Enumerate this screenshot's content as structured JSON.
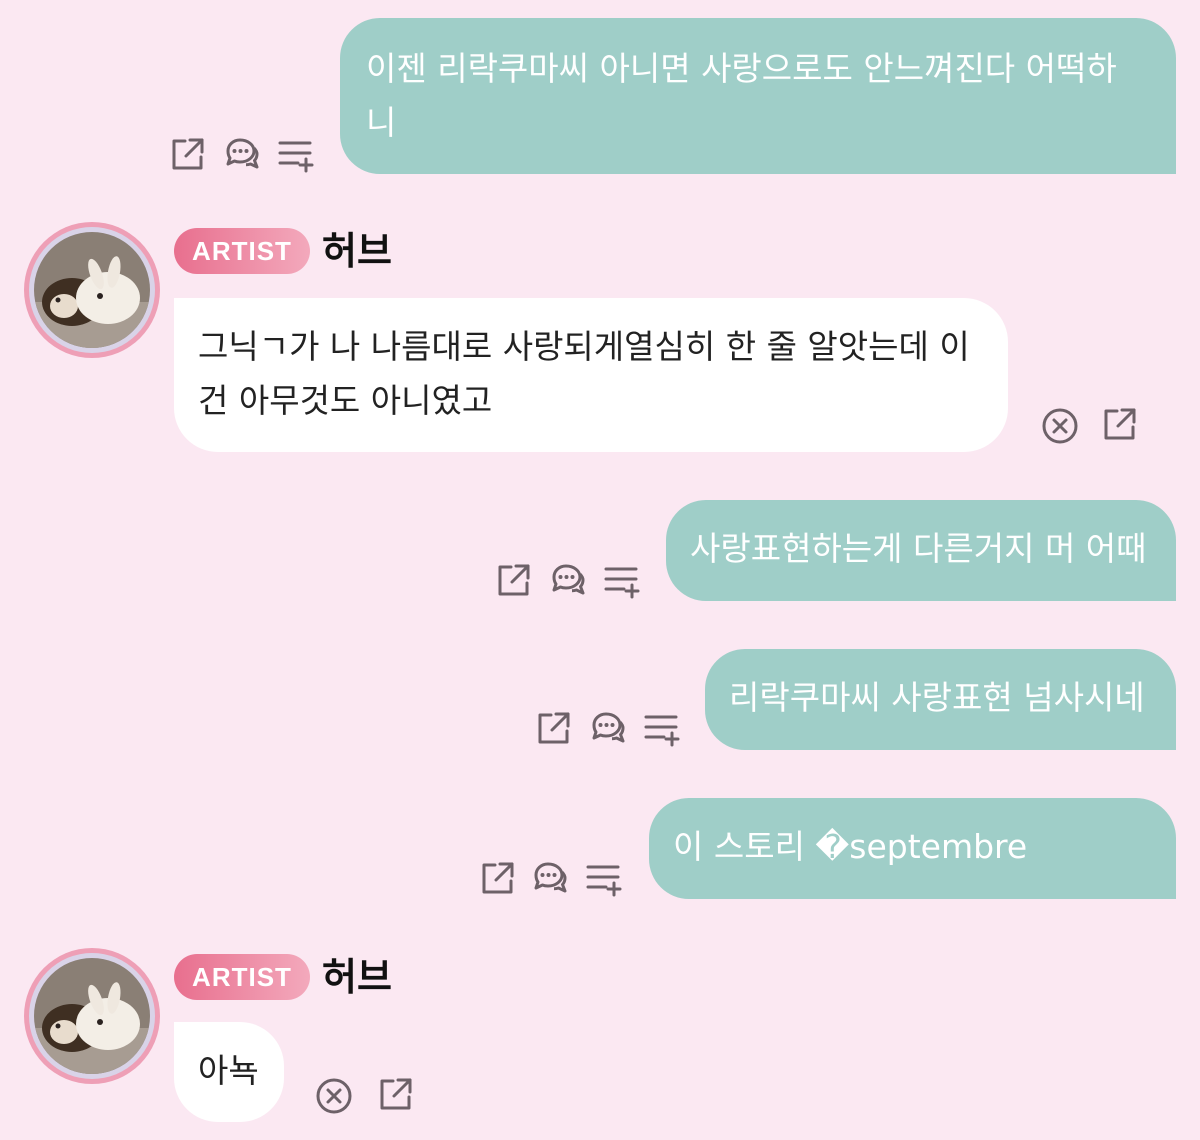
{
  "theme": {
    "background": "#fbe8f2",
    "outgoing_bubble": "#9fcec8",
    "incoming_bubble": "#ffffff",
    "badge_gradient": [
      "#e86f8e",
      "#f3a9bc"
    ],
    "icon_color": "#6d6168"
  },
  "messages": [
    {
      "type": "outgoing",
      "text": "이젠 리락쿠마씨 아니면 사랑으로도 안느껴진다 어떡하\n니",
      "actions": [
        "share-icon",
        "comment-icon",
        "add-to-list-icon"
      ]
    },
    {
      "type": "incoming",
      "badge": "ARTIST",
      "name": "허브",
      "text": "그닉ㄱ가 나 나름대로 사랑되게열심히 한 줄 알앗는데 이\n건 아무것도 아니였고",
      "actions": [
        "close-circle-icon",
        "share-icon"
      ]
    },
    {
      "type": "outgoing",
      "text": "사랑표현하는게 다른거지 머 어때",
      "actions": [
        "share-icon",
        "comment-icon",
        "add-to-list-icon"
      ]
    },
    {
      "type": "outgoing",
      "text": "리락쿠마씨 사랑표현 넘사시네",
      "actions": [
        "share-icon",
        "comment-icon",
        "add-to-list-icon"
      ]
    },
    {
      "type": "outgoing",
      "text": "이 스토리 �septembre",
      "actions": [
        "share-icon",
        "comment-icon",
        "add-to-list-icon"
      ]
    },
    {
      "type": "incoming",
      "badge": "ARTIST",
      "name": "허브",
      "text": "아뇩",
      "actions": [
        "close-circle-icon",
        "share-icon"
      ]
    }
  ]
}
